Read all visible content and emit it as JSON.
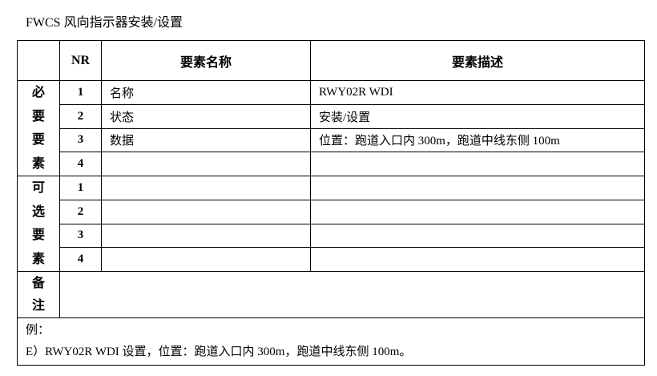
{
  "title": "FWCS 风向指示器安装/设置",
  "header": {
    "nr": "NR",
    "name": "要素名称",
    "desc": "要素描述"
  },
  "required": {
    "label": [
      "必",
      "要",
      "要",
      "素"
    ],
    "rows": [
      {
        "nr": "1",
        "name": "名称",
        "desc": "RWY02R WDI"
      },
      {
        "nr": "2",
        "name": "状态",
        "desc": "安装/设置"
      },
      {
        "nr": "3",
        "name": "数据",
        "desc": "位置：跑道入口内 300m，跑道中线东侧 100m"
      },
      {
        "nr": "4",
        "name": "",
        "desc": ""
      }
    ]
  },
  "optional": {
    "label": [
      "可",
      "选",
      "要",
      "素"
    ],
    "rows": [
      {
        "nr": "1",
        "name": "",
        "desc": ""
      },
      {
        "nr": "2",
        "name": "",
        "desc": ""
      },
      {
        "nr": "3",
        "name": "",
        "desc": ""
      },
      {
        "nr": "4",
        "name": "",
        "desc": ""
      }
    ]
  },
  "remark": {
    "label": [
      "备",
      "注"
    ],
    "content": ""
  },
  "example": {
    "label": "例：",
    "text": "E）RWY02R WDI 设置，位置：跑道入口内 300m，跑道中线东侧 100m。"
  }
}
